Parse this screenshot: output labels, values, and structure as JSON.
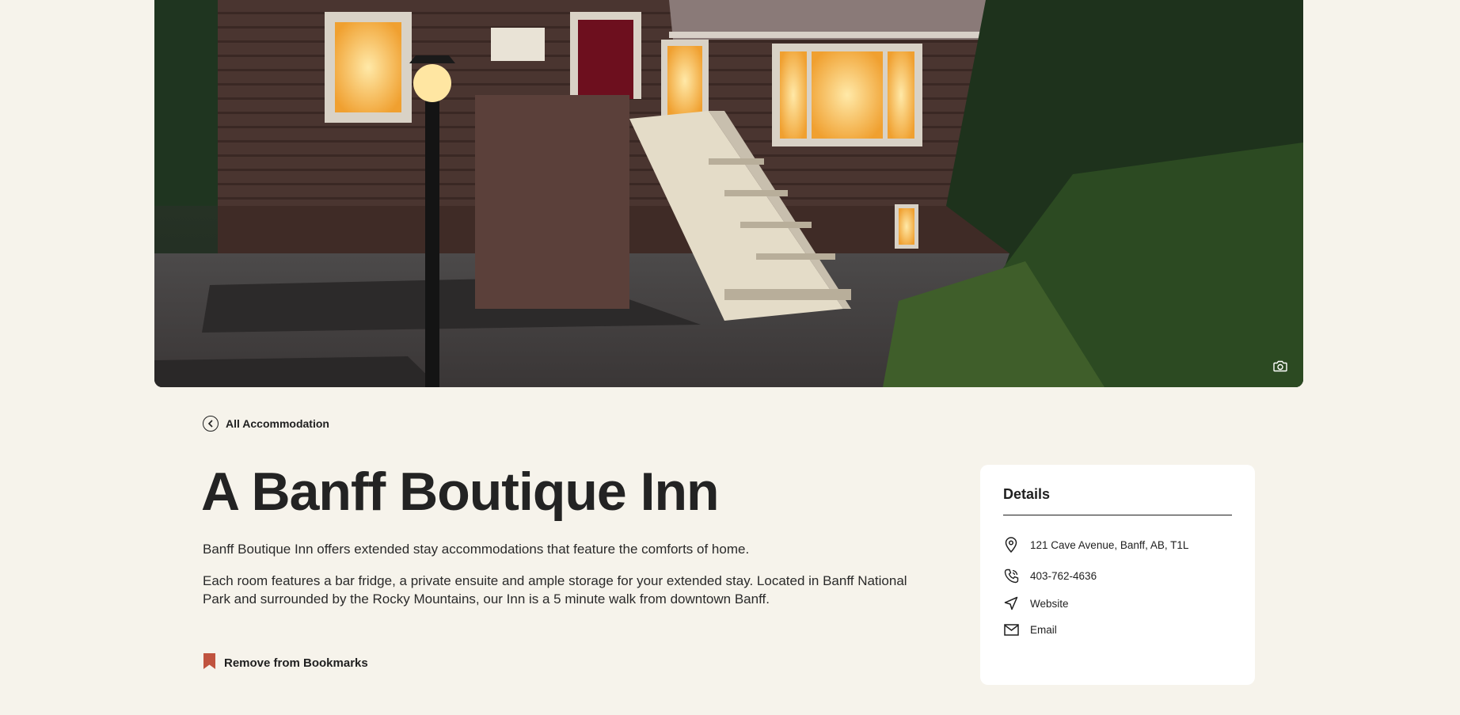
{
  "hero": {
    "alt": "Banff Boutique Inn exterior at dusk",
    "camera_icon": "camera-icon"
  },
  "nav": {
    "back_label": "All Accommodation",
    "back_icon": "chevron-left-circle-icon"
  },
  "listing": {
    "title": "A Banff Boutique Inn",
    "paragraphs": [
      "Banff Boutique Inn offers extended stay accommodations that feature the comforts of home.",
      "Each room features a bar fridge, a private ensuite and ample storage for your extended stay. Located in Banff National Park and surrounded by the Rocky Mountains, our Inn is a 5 minute walk from downtown Banff."
    ],
    "bookmark_label": "Remove from Bookmarks",
    "bookmark_color": "#c0533f"
  },
  "details": {
    "heading": "Details",
    "address": "121 Cave Avenue, Banff, AB, T1L",
    "phone": "403-762-4636",
    "website_label": "Website",
    "email_label": "Email"
  }
}
